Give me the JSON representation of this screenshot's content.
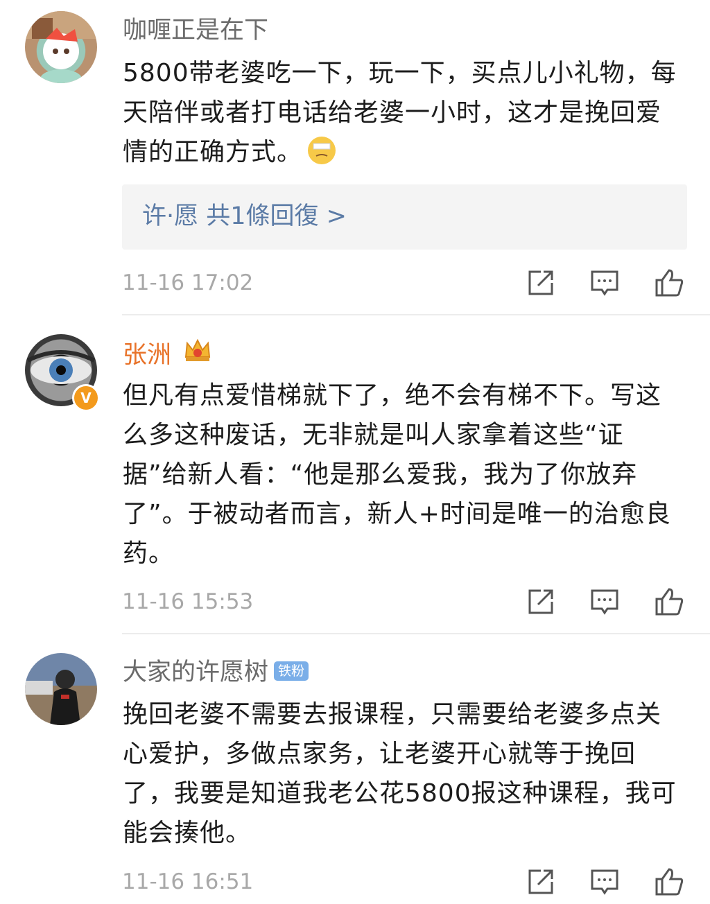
{
  "comments": [
    {
      "username": "咖喱正是在下",
      "text": "5800带老婆吃一下，玩一下，买点儿小礼物，每天陪伴或者打电话给老婆一小时，这才是挽回爱情的正确方式。",
      "reply_preview": "许·愿  共1條回復 >",
      "timestamp": "11-16 17:02",
      "emoji_icon": "exhausted-face-icon"
    },
    {
      "username": "张洲",
      "verified_badge": "V",
      "crown_icon": "crown-icon",
      "text": "但凡有点爱惜梯就下了，绝不会有梯不下。写这么多这种废话，无非就是叫人家拿着这些“证据”给新人看：“他是那么爱我，我为了你放弃了”。于被动者而言，新人+时间是唯一的治愈良药。",
      "timestamp": "11-16 15:53"
    },
    {
      "username": "大家的许愿树",
      "fan_badge": "铁粉",
      "text": "挽回老婆不需要去报课程，只需要给老婆多点关心爱护，多做点家务，让老婆开心就等于挽回了，我要是知道我老公花5800报这种课程，我可能会揍他。",
      "timestamp": "11-16 16:51"
    }
  ],
  "actions": {
    "share_icon": "share-icon",
    "comment_icon": "comment-icon",
    "like_icon": "like-icon"
  },
  "colors": {
    "vip_name": "#e8732a",
    "reply_link": "#5b7ba6",
    "badge_bg": "#7aaee8",
    "verified": "#f39a1c"
  }
}
